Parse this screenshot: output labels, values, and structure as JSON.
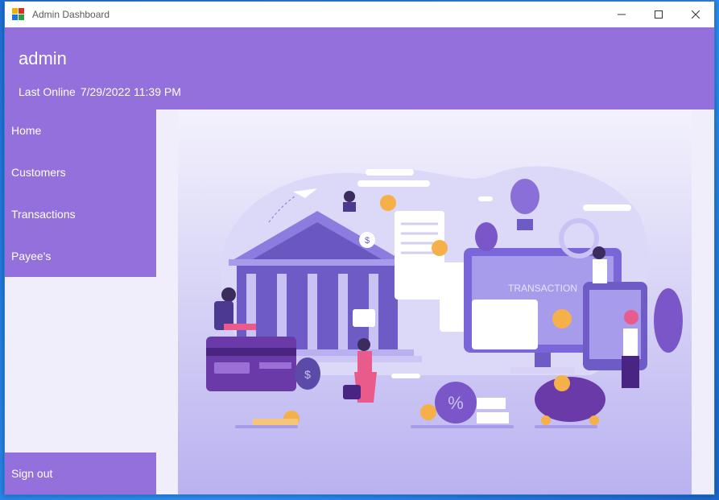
{
  "window": {
    "title": "Admin Dashboard",
    "icon": "app-grid-icon",
    "controls": [
      "minimize-icon",
      "maximize-icon",
      "close-icon"
    ]
  },
  "header": {
    "username": "admin",
    "last_online_label": "Last Online",
    "last_online_value": "7/29/2022 11:39 PM"
  },
  "sidebar": {
    "items": [
      {
        "label": "Home"
      },
      {
        "label": "Customers"
      },
      {
        "label": "Transactions"
      },
      {
        "label": "Payee's"
      }
    ],
    "signout_label": "Sign out"
  },
  "illustration": {
    "screen_text": "TRANSACTION",
    "subject": "bank-finance-illustration"
  },
  "colors": {
    "accent": "#9370db",
    "content_bg": "#efeefa",
    "illustration_purple": "#7a5fd0"
  }
}
